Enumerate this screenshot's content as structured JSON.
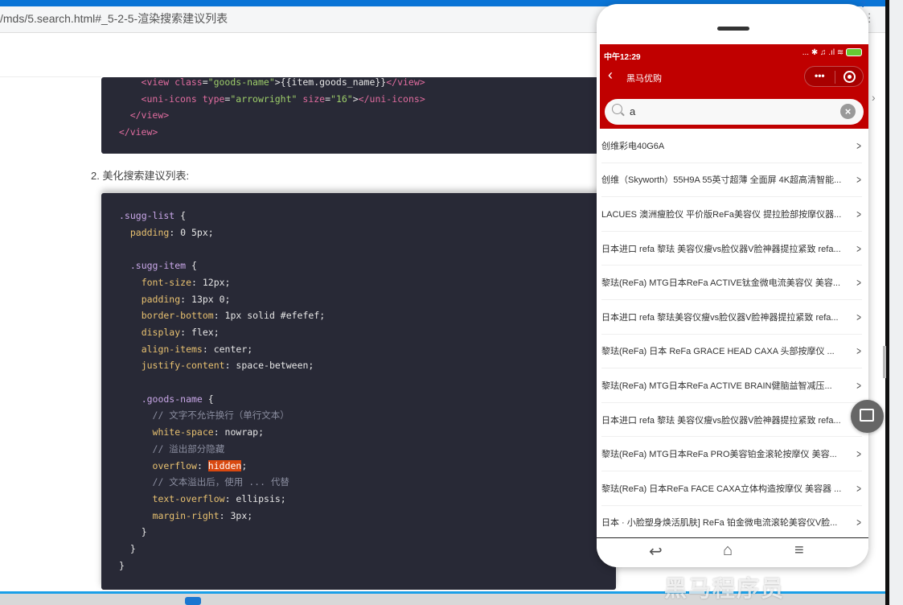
{
  "browser": {
    "address": "/mds/5.search.html#_5-2-5-渲染搜索建议列表",
    "help": "?"
  },
  "doc": {
    "step2": "2. 美化搜索建议列表:",
    "code1": [
      [
        [
          "t-pl",
          "      "
        ],
        [
          "t-tag",
          "<view "
        ],
        [
          "t-attr",
          "class"
        ],
        [
          "t-pl",
          "="
        ],
        [
          "t-str",
          "\"goods-name\""
        ],
        [
          "t-pl",
          ">{{item.goods_name}}"
        ],
        [
          "t-tag",
          "</view>"
        ]
      ],
      [
        [
          "t-pl",
          "      "
        ],
        [
          "t-tag",
          "<uni-icons "
        ],
        [
          "t-attr",
          "type"
        ],
        [
          "t-pl",
          "="
        ],
        [
          "t-str",
          "\"arrowright\""
        ],
        [
          "t-pl",
          " "
        ],
        [
          "t-attr",
          "size"
        ],
        [
          "t-pl",
          "="
        ],
        [
          "t-str",
          "\"16\""
        ],
        [
          "t-pl",
          ">"
        ],
        [
          "t-tag",
          "</uni-icons>"
        ]
      ],
      [
        [
          "t-pl",
          "    "
        ],
        [
          "t-tag",
          "</view>"
        ]
      ],
      [
        [
          "t-pl",
          "  "
        ],
        [
          "t-tag",
          "</view>"
        ]
      ]
    ],
    "code2": [
      [
        [
          "t-sel",
          ".sugg-list "
        ],
        [
          "t-pl",
          "{"
        ]
      ],
      [
        [
          "t-prop",
          "  padding"
        ],
        [
          "t-pl",
          ": 0 5px;"
        ]
      ],
      [
        [
          "t-pl",
          ""
        ]
      ],
      [
        [
          "t-sel",
          "  .sugg-item "
        ],
        [
          "t-pl",
          "{"
        ]
      ],
      [
        [
          "t-prop",
          "    font-size"
        ],
        [
          "t-pl",
          ": 12px;"
        ]
      ],
      [
        [
          "t-prop",
          "    padding"
        ],
        [
          "t-pl",
          ": 13px 0;"
        ]
      ],
      [
        [
          "t-prop",
          "    border-bottom"
        ],
        [
          "t-pl",
          ": 1px solid #efefef;"
        ]
      ],
      [
        [
          "t-prop",
          "    display"
        ],
        [
          "t-pl",
          ": flex;"
        ]
      ],
      [
        [
          "t-prop",
          "    align-items"
        ],
        [
          "t-pl",
          ": center;"
        ]
      ],
      [
        [
          "t-prop",
          "    justify-content"
        ],
        [
          "t-pl",
          ": space-between;"
        ]
      ],
      [
        [
          "t-pl",
          ""
        ]
      ],
      [
        [
          "t-sel",
          "    .goods-name "
        ],
        [
          "t-pl",
          "{"
        ]
      ],
      [
        [
          "t-com",
          "      // 文字不允许换行（单行文本）"
        ]
      ],
      [
        [
          "t-prop",
          "      white-space"
        ],
        [
          "t-pl",
          ": nowrap;"
        ]
      ],
      [
        [
          "t-com",
          "      // 溢出部分隐藏"
        ]
      ],
      [
        [
          "t-prop",
          "      overflow"
        ],
        [
          "t-pl",
          ": "
        ],
        [
          "t-hl",
          "hidden"
        ],
        [
          "t-pl",
          ";"
        ]
      ],
      [
        [
          "t-com",
          "      // 文本溢出后，使用 ... 代替"
        ]
      ],
      [
        [
          "t-prop",
          "      text-overflow"
        ],
        [
          "t-pl",
          ": ellipsis;"
        ]
      ],
      [
        [
          "t-prop",
          "      margin-right"
        ],
        [
          "t-pl",
          ": 3px;"
        ]
      ],
      [
        [
          "t-pl",
          "    }"
        ]
      ],
      [
        [
          "t-pl",
          "  }"
        ]
      ],
      [
        [
          "t-pl",
          "}"
        ]
      ]
    ]
  },
  "phone": {
    "time": "中午12:29",
    "status_icons": "... ✱ ♫ .ıl ≋",
    "title": "黑马优购",
    "search_value": "a",
    "accent": "#c00000",
    "items": [
      "创维彩电40G6A",
      "创维（Skyworth）55H9A 55英寸超薄 全面屏 4K超高清智能...",
      "LACUES 澳洲瘦脸仪 平价版ReFa美容仪 提拉脸部按摩仪器...",
      "日本进口 refa 黎珐 美容仪瘦vs脸仪器V脸神器提拉紧致 refa...",
      "黎珐(ReFa) MTG日本ReFa ACTIVE钛金微电流美容仪 美容...",
      "日本进口 refa 黎珐美容仪瘦vs脸仪器V脸神器提拉紧致 refa...",
      "黎珐(ReFa) 日本 ReFa GRACE HEAD CAXA 头部按摩仪 ...",
      "黎珐(ReFa) MTG日本ReFa ACTIVE BRAIN健脑益智减压...",
      "日本进口 refa 黎珐 美容仪瘦vs脸仪器V脸神器提拉紧致 refa...",
      "黎珐(ReFa) MTG日本ReFa PRO美容铂金滚轮按摩仪 美容...",
      "黎珐(ReFa) 日本ReFa FACE CAXA立体构造按摩仪 美容器 ...",
      "日本 · 小脸塑身焕活肌肤] ReFa 铂金微电流滚轮美容仪V脸..."
    ]
  },
  "watermark": "黑马程序员"
}
